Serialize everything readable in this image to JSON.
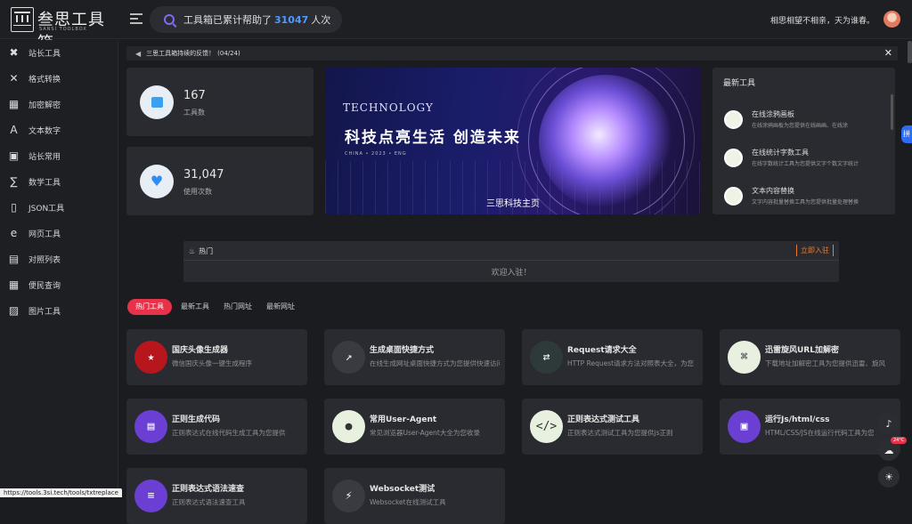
{
  "header": {
    "logo_title": "叁思工具箱",
    "logo_sub": "SANSI TOOLBOX",
    "search_prefix": "工具箱已累计帮助了",
    "search_count": "31047",
    "search_suffix": "人次",
    "motto": "相思相望不相亲，天为谁春。"
  },
  "sidebar": {
    "items": [
      {
        "label": "站长工具",
        "icon": "wrench-icon"
      },
      {
        "label": "格式转换",
        "icon": "convert-icon"
      },
      {
        "label": "加密解密",
        "icon": "lock-icon"
      },
      {
        "label": "文本数字",
        "icon": "text-icon"
      },
      {
        "label": "站长常用",
        "icon": "toolbox-icon"
      },
      {
        "label": "数学工具",
        "icon": "math-icon"
      },
      {
        "label": "JSON工具",
        "icon": "json-icon"
      },
      {
        "label": "网页工具",
        "icon": "browser-icon"
      },
      {
        "label": "对照列表",
        "icon": "list-icon"
      },
      {
        "label": "便民查询",
        "icon": "calendar-icon"
      },
      {
        "label": "图片工具",
        "icon": "image-icon"
      }
    ]
  },
  "notice": {
    "text": "三思工具箱持续的反馈！",
    "counter": "(04/24)"
  },
  "stats": [
    {
      "value": "167",
      "label": "工具数",
      "icon": "box-icon"
    },
    {
      "value": "31,047",
      "label": "使用次数",
      "icon": "heart-icon"
    }
  ],
  "banner": {
    "tech": "TECHNOLOGY",
    "slogan": "科技点亮生活 创造未来",
    "small": "CHINA • 2023 • ENG",
    "caption": "三思科技主页"
  },
  "newest": {
    "title": "最新工具",
    "items": [
      {
        "title": "在线涂鸦画板",
        "desc": "在线涂鸦画板为您提供在线画画、在线涂"
      },
      {
        "title": "在线统计字数工具",
        "desc": "在线字数统计工具为您提供文字个数文字统计"
      },
      {
        "title": "文本内容替换",
        "desc": "文字内容批量替换工具为您提供批量处理替换"
      }
    ]
  },
  "hot": {
    "label": "热门",
    "join": "立即入驻",
    "body": "欢迎入驻！"
  },
  "tabs": [
    "热门工具",
    "最新工具",
    "热门网址",
    "最新网址"
  ],
  "cards": [
    {
      "title": "国庆头像生成器",
      "desc": "微信国庆头像一键生成程序",
      "icon": "flag-avatar-icon",
      "bg": "#b8161d",
      "glyph": "★"
    },
    {
      "title": "生成桌面快捷方式",
      "desc": "在线生成网址桌面快捷方式为您提供快速访问",
      "icon": "shortcut-icon",
      "bg": "#3a3b40",
      "glyph": "↗"
    },
    {
      "title": "Request请求大全",
      "desc": "HTTP Request请求方法对照表大全，为您",
      "icon": "request-icon",
      "bg": "#2e3a3a",
      "glyph": "⇄"
    },
    {
      "title": "迅雷旋风URL加解密",
      "desc": "下载地址加解密工具为您提供迅雷、旋风",
      "icon": "url-crypt-icon",
      "bg": "#e8f0e0",
      "glyph": "⌘"
    },
    {
      "title": "正则生成代码",
      "desc": "正则表达式在线代码生成工具为您提供",
      "icon": "regex-code-icon",
      "bg": "#6b3fd4",
      "glyph": "▤"
    },
    {
      "title": "常用User-Agent",
      "desc": "常见浏览器User-Agent大全为您收录",
      "icon": "user-agent-icon",
      "bg": "#e8f0e0",
      "glyph": "●"
    },
    {
      "title": "正则表达式测试工具",
      "desc": "正则表达式测试工具为您提供js正则",
      "icon": "regex-test-icon",
      "bg": "#e8f0e0",
      "glyph": "</>"
    },
    {
      "title": "运行Js/html/css",
      "desc": "HTML/CSS/JS在线运行代码工具为您",
      "icon": "run-code-icon",
      "bg": "#6b3fd4",
      "glyph": "▣"
    },
    {
      "title": "正则表达式语法速查",
      "desc": "正则表达式语法速查工具",
      "icon": "regex-syntax-icon",
      "bg": "#6b3fd4",
      "glyph": "≡"
    },
    {
      "title": "Websocket测试",
      "desc": "Websocket在线测试工具",
      "icon": "websocket-icon",
      "bg": "#3a3b40",
      "glyph": "⚡"
    }
  ],
  "float": {
    "temp": "24°C"
  },
  "status_url": "https://tools.3si.tech/tools/txtreplace"
}
